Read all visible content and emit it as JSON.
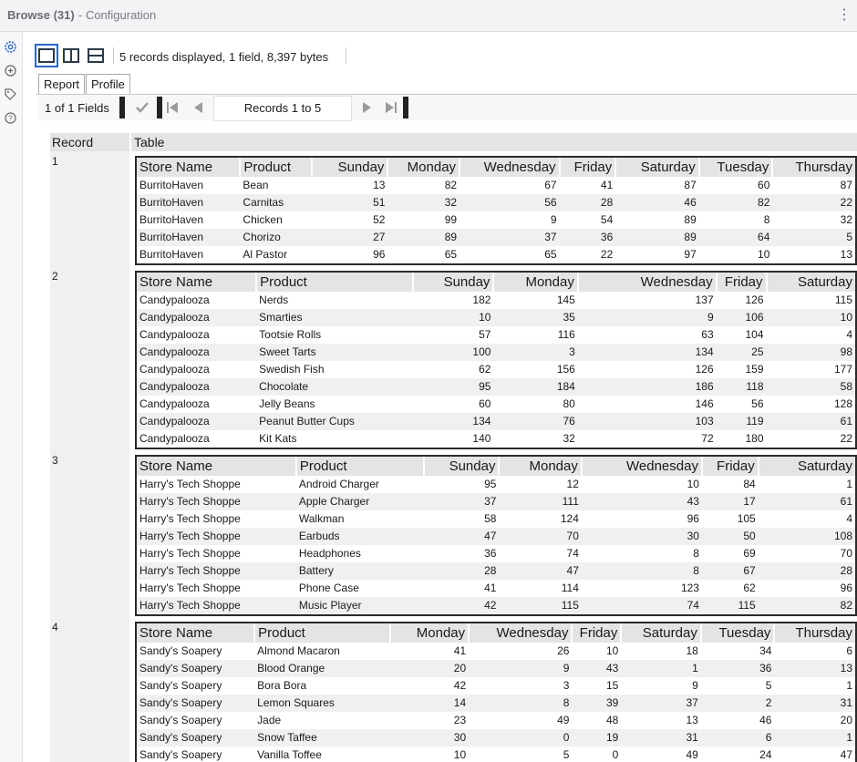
{
  "window": {
    "title": "Browse (31)",
    "subtitle": "- Configuration",
    "menu_glyph": "⋮"
  },
  "rail": {
    "icons": [
      "gear-icon",
      "crosshair-icon",
      "tag-icon",
      "help-icon"
    ]
  },
  "toolbar": {
    "status": "5 records displayed, 1 field, 8,397 bytes"
  },
  "tabs": [
    "Report",
    "Profile"
  ],
  "navbar": {
    "fields": "1 of 1 Fields",
    "records": "Records 1 to 5"
  },
  "grid": {
    "headers": [
      "Record",
      "Table"
    ],
    "records": [
      {
        "num": "1",
        "columns": [
          "Store Name",
          "Product",
          "Sunday",
          "Monday",
          "Wednesday",
          "Friday",
          "Saturday",
          "Tuesday",
          "Thursday"
        ],
        "rows": [
          [
            "BurritoHaven",
            "Bean",
            "13",
            "82",
            "67",
            "41",
            "87",
            "60",
            "87"
          ],
          [
            "BurritoHaven",
            "Carnitas",
            "51",
            "32",
            "56",
            "28",
            "46",
            "82",
            "22"
          ],
          [
            "BurritoHaven",
            "Chicken",
            "52",
            "99",
            "9",
            "54",
            "89",
            "8",
            "32"
          ],
          [
            "BurritoHaven",
            "Chorizo",
            "27",
            "89",
            "37",
            "36",
            "89",
            "64",
            "5"
          ],
          [
            "BurritoHaven",
            "Al Pastor",
            "96",
            "65",
            "65",
            "22",
            "97",
            "10",
            "13"
          ]
        ]
      },
      {
        "num": "2",
        "columns": [
          "Store Name",
          "Product",
          "Sunday",
          "Monday",
          "Wednesday",
          "Friday",
          "Saturday"
        ],
        "rows": [
          [
            "Candypalooza",
            "Nerds",
            "182",
            "145",
            "137",
            "126",
            "115"
          ],
          [
            "Candypalooza",
            "Smarties",
            "10",
            "35",
            "9",
            "106",
            "10"
          ],
          [
            "Candypalooza",
            "Tootsie Rolls",
            "57",
            "116",
            "63",
            "104",
            "4"
          ],
          [
            "Candypalooza",
            "Sweet Tarts",
            "100",
            "3",
            "134",
            "25",
            "98"
          ],
          [
            "Candypalooza",
            "Swedish Fish",
            "62",
            "156",
            "126",
            "159",
            "177"
          ],
          [
            "Candypalooza",
            "Chocolate",
            "95",
            "184",
            "186",
            "118",
            "58"
          ],
          [
            "Candypalooza",
            "Jelly Beans",
            "60",
            "80",
            "146",
            "56",
            "128"
          ],
          [
            "Candypalooza",
            "Peanut Butter Cups",
            "134",
            "76",
            "103",
            "119",
            "61"
          ],
          [
            "Candypalooza",
            "Kit Kats",
            "140",
            "32",
            "72",
            "180",
            "22"
          ]
        ]
      },
      {
        "num": "3",
        "columns": [
          "Store Name",
          "Product",
          "Sunday",
          "Monday",
          "Wednesday",
          "Friday",
          "Saturday"
        ],
        "rows": [
          [
            "Harry's Tech Shoppe",
            "Android Charger",
            "95",
            "12",
            "10",
            "84",
            "1"
          ],
          [
            "Harry's Tech Shoppe",
            "Apple Charger",
            "37",
            "111",
            "43",
            "17",
            "61"
          ],
          [
            "Harry's Tech Shoppe",
            "Walkman",
            "58",
            "124",
            "96",
            "105",
            "4"
          ],
          [
            "Harry's Tech Shoppe",
            "Earbuds",
            "47",
            "70",
            "30",
            "50",
            "108"
          ],
          [
            "Harry's Tech Shoppe",
            "Headphones",
            "36",
            "74",
            "8",
            "69",
            "70"
          ],
          [
            "Harry's Tech Shoppe",
            "Battery",
            "28",
            "47",
            "8",
            "67",
            "28"
          ],
          [
            "Harry's Tech Shoppe",
            "Phone Case",
            "41",
            "114",
            "123",
            "62",
            "96"
          ],
          [
            "Harry's Tech Shoppe",
            "Music Player",
            "42",
            "115",
            "74",
            "115",
            "82"
          ]
        ]
      },
      {
        "num": "4",
        "columns": [
          "Store Name",
          "Product",
          "Monday",
          "Wednesday",
          "Friday",
          "Saturday",
          "Tuesday",
          "Thursday"
        ],
        "rows": [
          [
            "Sandy's Soapery",
            "Almond Macaron",
            "41",
            "26",
            "10",
            "18",
            "34",
            "6"
          ],
          [
            "Sandy's Soapery",
            "Blood Orange",
            "20",
            "9",
            "43",
            "1",
            "36",
            "13"
          ],
          [
            "Sandy's Soapery",
            "Bora Bora",
            "42",
            "3",
            "15",
            "9",
            "5",
            "1"
          ],
          [
            "Sandy's Soapery",
            "Lemon Squares",
            "14",
            "8",
            "39",
            "37",
            "2",
            "31"
          ],
          [
            "Sandy's Soapery",
            "Jade",
            "23",
            "49",
            "48",
            "13",
            "46",
            "20"
          ],
          [
            "Sandy's Soapery",
            "Snow Taffee",
            "30",
            "0",
            "19",
            "31",
            "6",
            "1"
          ],
          [
            "Sandy's Soapery",
            "Vanilla Toffee",
            "10",
            "5",
            "0",
            "49",
            "24",
            "47"
          ]
        ]
      }
    ]
  }
}
